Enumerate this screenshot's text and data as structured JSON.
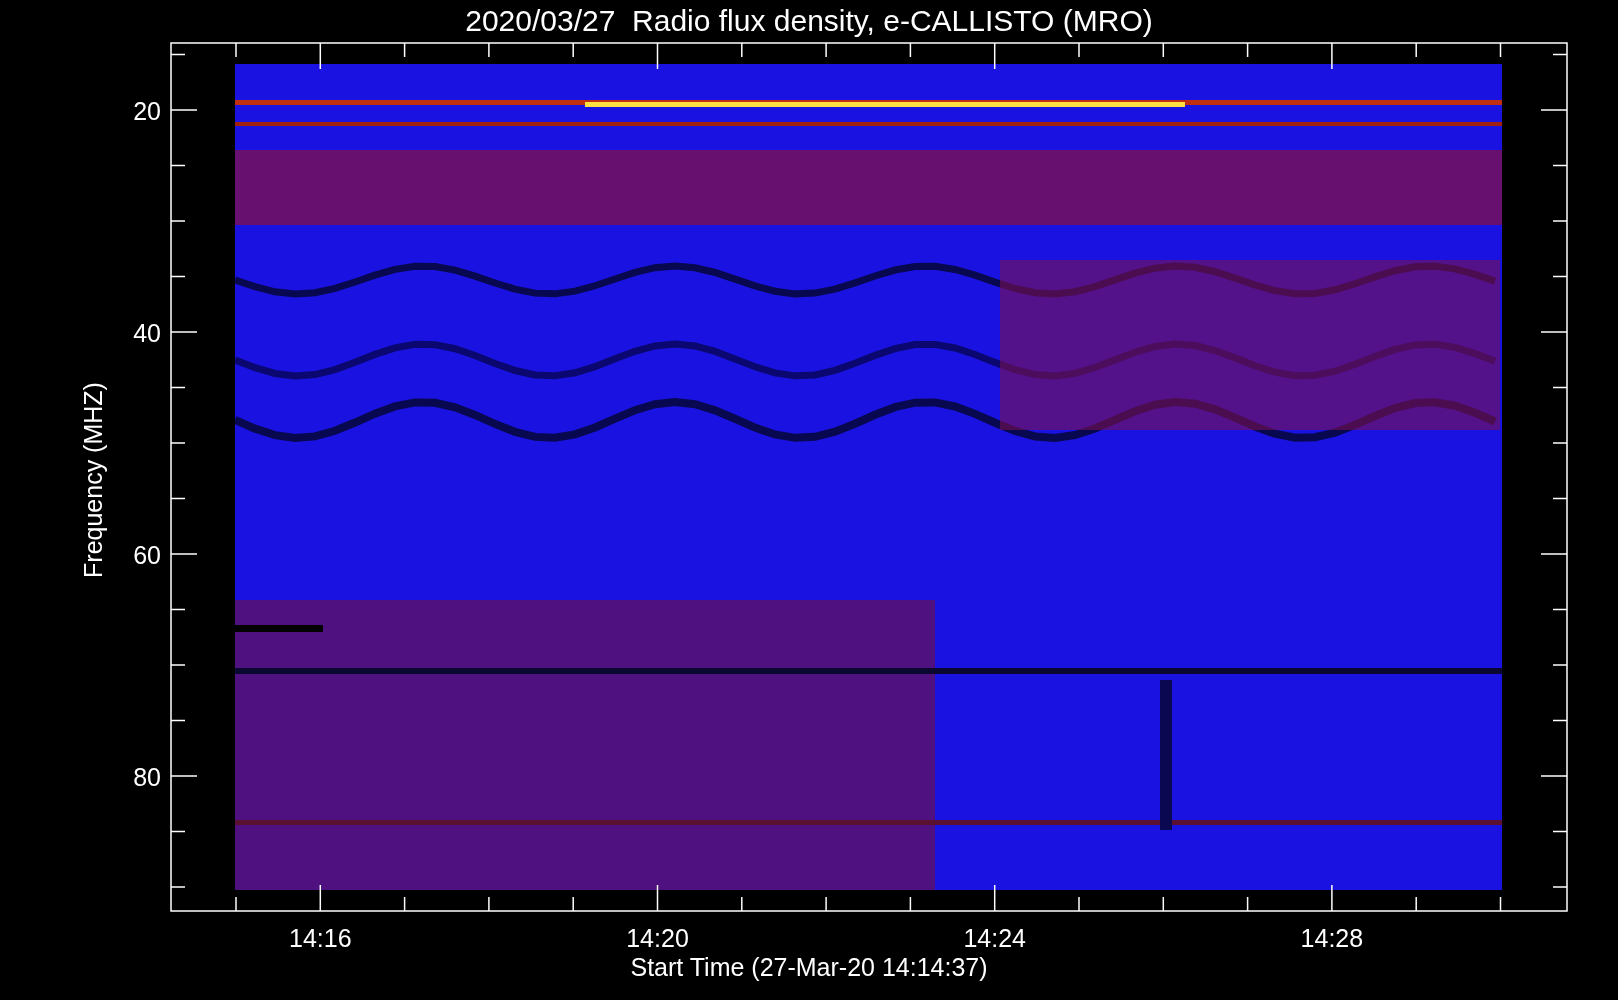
{
  "title": "2020/03/27  Radio flux density, e-CALLISTO (MRO)",
  "y_axis": {
    "label": "Frequency (MHZ)",
    "ticks": [
      "20",
      "40",
      "60",
      "80"
    ]
  },
  "x_axis": {
    "label": "Start Time (27-Mar-20 14:14:37)",
    "ticks": [
      "14:16",
      "14:20",
      "14:24",
      "14:28"
    ]
  }
}
